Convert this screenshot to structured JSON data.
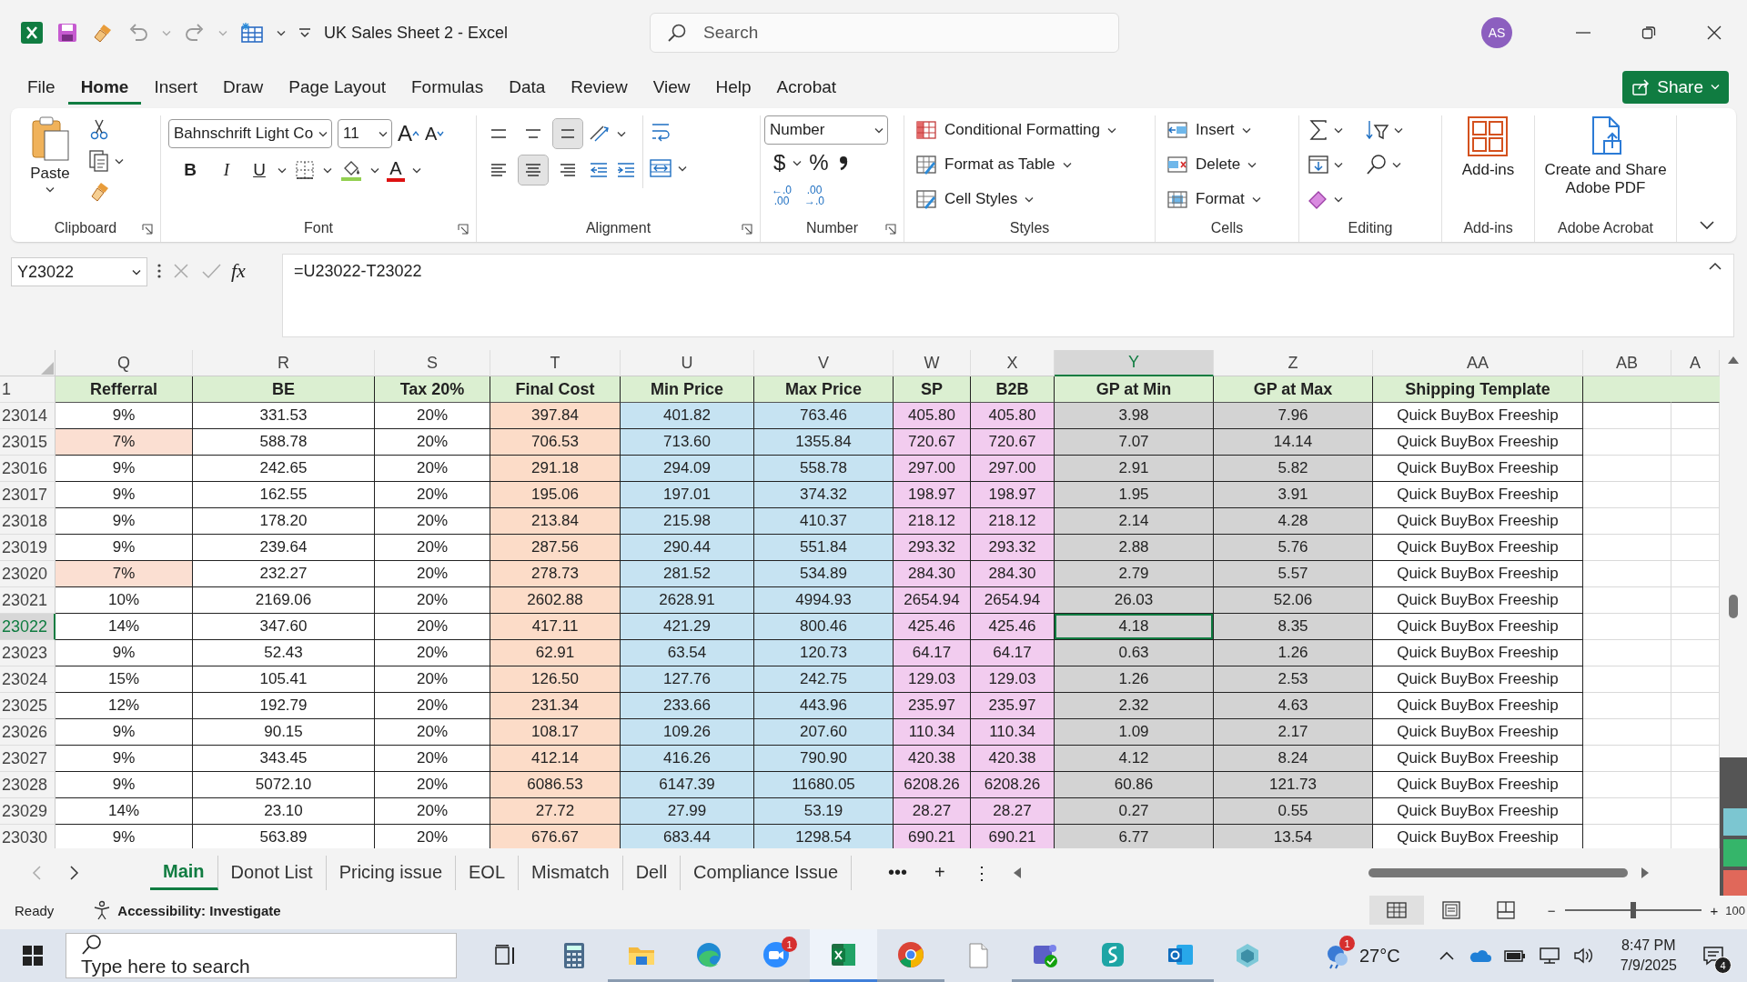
{
  "title_bar": {
    "document_title": "UK Sales Sheet 2  -  Excel",
    "search_placeholder": "Search",
    "avatar": "AS"
  },
  "menu_tabs": [
    {
      "label": "File",
      "selected": false
    },
    {
      "label": "Home",
      "selected": true
    },
    {
      "label": "Insert",
      "selected": false
    },
    {
      "label": "Draw",
      "selected": false
    },
    {
      "label": "Page Layout",
      "selected": false
    },
    {
      "label": "Formulas",
      "selected": false
    },
    {
      "label": "Data",
      "selected": false
    },
    {
      "label": "Review",
      "selected": false
    },
    {
      "label": "View",
      "selected": false
    },
    {
      "label": "Help",
      "selected": false
    },
    {
      "label": "Acrobat",
      "selected": false
    }
  ],
  "share_button": "Share",
  "ribbon": {
    "clipboard": {
      "label": "Clipboard",
      "paste": "Paste"
    },
    "font": {
      "label": "Font",
      "font_name": "Bahnschrift Light Co",
      "font_size": "11",
      "grow": "A",
      "shrink": "A",
      "bold": "B",
      "italic": "I",
      "underline": "U",
      "font_color": "A"
    },
    "alignment": {
      "label": "Alignment",
      "vertical": [
        {
          "kind": "top",
          "selected": false
        },
        {
          "kind": "middle",
          "selected": false
        },
        {
          "kind": "bottom",
          "selected": true
        }
      ],
      "horizontal": [
        {
          "kind": "left",
          "selected": false
        },
        {
          "kind": "center",
          "selected": true
        },
        {
          "kind": "right",
          "selected": false
        }
      ]
    },
    "number": {
      "label": "Number",
      "format": "Number",
      "currency": "$",
      "percent": "%",
      "increase_decimal": [
        "←.0",
        ".00"
      ],
      "decrease_decimal": [
        ".00",
        "→.0"
      ]
    },
    "styles": {
      "label": "Styles",
      "items": [
        {
          "kind": "conditional",
          "label": "Conditional Formatting"
        },
        {
          "kind": "table",
          "label": "Format as Table"
        },
        {
          "kind": "cell",
          "label": "Cell Styles"
        }
      ]
    },
    "cells": {
      "label": "Cells",
      "items": [
        {
          "kind": "insert",
          "label": "Insert"
        },
        {
          "kind": "delete",
          "label": "Delete"
        },
        {
          "kind": "format",
          "label": "Format"
        }
      ]
    },
    "editing": {
      "label": "Editing"
    },
    "add_ins": {
      "label": "Add-ins",
      "button": "Add-ins"
    },
    "adobe": {
      "label": "Adobe Acrobat",
      "button": "Create and Share Adobe PDF"
    }
  },
  "formula_bar": {
    "name_box": "Y23022",
    "fx": "fx",
    "formula": "=U23022-T23022"
  },
  "sheet": {
    "header_row_number": "1",
    "columns": [
      {
        "letter": "Q",
        "header": "Refferral",
        "color": "#ffffff",
        "selected": false
      },
      {
        "letter": "R",
        "header": "BE",
        "color": "#ffffff",
        "selected": false
      },
      {
        "letter": "S",
        "header": "Tax 20%",
        "color": "#ffffff",
        "selected": false
      },
      {
        "letter": "T",
        "header": "Final Cost",
        "color": "#fcdcc8",
        "selected": false
      },
      {
        "letter": "U",
        "header": "Min Price",
        "color": "#c6e3f2",
        "selected": false
      },
      {
        "letter": "V",
        "header": "Max Price",
        "color": "#c6e3f2",
        "selected": false
      },
      {
        "letter": "W",
        "header": "SP",
        "color": "#f2ccef",
        "selected": false
      },
      {
        "letter": "X",
        "header": "B2B",
        "color": "#f2ccef",
        "selected": false
      },
      {
        "letter": "Y",
        "header": "GP at Min",
        "color": "#d3d3d3",
        "selected": true
      },
      {
        "letter": "Z",
        "header": "GP at Max",
        "color": "#d3d3d3",
        "selected": false
      },
      {
        "letter": "AA",
        "header": "Shipping Template",
        "color": "#ffffff",
        "selected": false
      },
      {
        "letter": "AB",
        "color": "#ffffff",
        "selected": false
      },
      {
        "letter": "A",
        "color": "#ffffff",
        "selected": false
      }
    ],
    "rows": [
      {
        "number": "23014",
        "selected": false,
        "referral_highlight": false,
        "cells": [
          "9%",
          "331.53",
          "20%",
          "397.84",
          "401.82",
          "763.46",
          "405.80",
          "405.80",
          "3.98",
          "7.96",
          "Quick BuyBox Freeship"
        ]
      },
      {
        "number": "23015",
        "selected": false,
        "referral_highlight": true,
        "cells": [
          "7%",
          "588.78",
          "20%",
          "706.53",
          "713.60",
          "1355.84",
          "720.67",
          "720.67",
          "7.07",
          "14.14",
          "Quick BuyBox Freeship"
        ]
      },
      {
        "number": "23016",
        "selected": false,
        "referral_highlight": false,
        "cells": [
          "9%",
          "242.65",
          "20%",
          "291.18",
          "294.09",
          "558.78",
          "297.00",
          "297.00",
          "2.91",
          "5.82",
          "Quick BuyBox Freeship"
        ]
      },
      {
        "number": "23017",
        "selected": false,
        "referral_highlight": false,
        "cells": [
          "9%",
          "162.55",
          "20%",
          "195.06",
          "197.01",
          "374.32",
          "198.97",
          "198.97",
          "1.95",
          "3.91",
          "Quick BuyBox Freeship"
        ]
      },
      {
        "number": "23018",
        "selected": false,
        "referral_highlight": false,
        "cells": [
          "9%",
          "178.20",
          "20%",
          "213.84",
          "215.98",
          "410.37",
          "218.12",
          "218.12",
          "2.14",
          "4.28",
          "Quick BuyBox Freeship"
        ]
      },
      {
        "number": "23019",
        "selected": false,
        "referral_highlight": false,
        "cells": [
          "9%",
          "239.64",
          "20%",
          "287.56",
          "290.44",
          "551.84",
          "293.32",
          "293.32",
          "2.88",
          "5.76",
          "Quick BuyBox Freeship"
        ]
      },
      {
        "number": "23020",
        "selected": false,
        "referral_highlight": true,
        "cells": [
          "7%",
          "232.27",
          "20%",
          "278.73",
          "281.52",
          "534.89",
          "284.30",
          "284.30",
          "2.79",
          "5.57",
          "Quick BuyBox Freeship"
        ]
      },
      {
        "number": "23021",
        "selected": false,
        "referral_highlight": false,
        "cells": [
          "10%",
          "2169.06",
          "20%",
          "2602.88",
          "2628.91",
          "4994.93",
          "2654.94",
          "2654.94",
          "26.03",
          "52.06",
          "Quick BuyBox Freeship"
        ]
      },
      {
        "number": "23022",
        "selected": true,
        "referral_highlight": false,
        "cells": [
          "14%",
          "347.60",
          "20%",
          "417.11",
          "421.29",
          "800.46",
          "425.46",
          "425.46",
          "4.18",
          "8.35",
          "Quick BuyBox Freeship"
        ]
      },
      {
        "number": "23023",
        "selected": false,
        "referral_highlight": false,
        "cells": [
          "9%",
          "52.43",
          "20%",
          "62.91",
          "63.54",
          "120.73",
          "64.17",
          "64.17",
          "0.63",
          "1.26",
          "Quick BuyBox Freeship"
        ]
      },
      {
        "number": "23024",
        "selected": false,
        "referral_highlight": false,
        "cells": [
          "15%",
          "105.41",
          "20%",
          "126.50",
          "127.76",
          "242.75",
          "129.03",
          "129.03",
          "1.26",
          "2.53",
          "Quick BuyBox Freeship"
        ]
      },
      {
        "number": "23025",
        "selected": false,
        "referral_highlight": false,
        "cells": [
          "12%",
          "192.79",
          "20%",
          "231.34",
          "233.66",
          "443.96",
          "235.97",
          "235.97",
          "2.32",
          "4.63",
          "Quick BuyBox Freeship"
        ]
      },
      {
        "number": "23026",
        "selected": false,
        "referral_highlight": false,
        "cells": [
          "9%",
          "90.15",
          "20%",
          "108.17",
          "109.26",
          "207.60",
          "110.34",
          "110.34",
          "1.09",
          "2.17",
          "Quick BuyBox Freeship"
        ]
      },
      {
        "number": "23027",
        "selected": false,
        "referral_highlight": false,
        "cells": [
          "9%",
          "343.45",
          "20%",
          "412.14",
          "416.26",
          "790.90",
          "420.38",
          "420.38",
          "4.12",
          "8.24",
          "Quick BuyBox Freeship"
        ]
      },
      {
        "number": "23028",
        "selected": false,
        "referral_highlight": false,
        "cells": [
          "9%",
          "5072.10",
          "20%",
          "6086.53",
          "6147.39",
          "11680.05",
          "6208.26",
          "6208.26",
          "60.86",
          "121.73",
          "Quick BuyBox Freeship"
        ]
      },
      {
        "number": "23029",
        "selected": false,
        "referral_highlight": false,
        "cells": [
          "14%",
          "23.10",
          "20%",
          "27.72",
          "27.99",
          "53.19",
          "28.27",
          "28.27",
          "0.27",
          "0.55",
          "Quick BuyBox Freeship"
        ]
      },
      {
        "number": "23030",
        "selected": false,
        "referral_highlight": false,
        "cells": [
          "9%",
          "563.89",
          "20%",
          "676.67",
          "683.44",
          "1298.54",
          "690.21",
          "690.21",
          "6.77",
          "13.54",
          "Quick BuyBox Freeship"
        ]
      }
    ]
  },
  "sheet_tabs": {
    "tabs": [
      {
        "label": "Main",
        "selected": true
      },
      {
        "label": "Donot List",
        "selected": false
      },
      {
        "label": "Pricing issue",
        "selected": false
      },
      {
        "label": "EOL",
        "selected": false
      },
      {
        "label": "Mismatch",
        "selected": false
      },
      {
        "label": "Dell",
        "selected": false
      },
      {
        "label": "Compliance Issue",
        "selected": false
      }
    ],
    "more": "•••",
    "add": "+",
    "options": "⋮"
  },
  "status_bar": {
    "status": "Ready",
    "accessibility": "Accessibility: Investigate",
    "views": [
      {
        "kind": "normal",
        "selected": true
      },
      {
        "kind": "page_layout",
        "selected": false
      },
      {
        "kind": "page_break",
        "selected": false
      }
    ],
    "zoom_out": "−",
    "zoom_in": "+",
    "zoom": {
      "level": 0.5
    },
    "zoom_text": "100"
  },
  "taskbar": {
    "search_placeholder": "Type here to search",
    "apps": [
      {
        "kind": "task_view",
        "running": false,
        "active": false
      },
      {
        "kind": "calculator",
        "running": false,
        "active": false
      },
      {
        "kind": "folder",
        "running": true,
        "active": false
      },
      {
        "kind": "edge",
        "running": true,
        "active": false
      },
      {
        "kind": "zoom",
        "running": true,
        "active": false,
        "badge": "1"
      },
      {
        "kind": "excel",
        "running": true,
        "active": true
      },
      {
        "kind": "chrome",
        "running": true,
        "active": false
      },
      {
        "kind": "notepad",
        "running": false,
        "active": false
      },
      {
        "kind": "teams",
        "running": true,
        "active": false
      },
      {
        "kind": "surfshark",
        "running": true,
        "active": false
      },
      {
        "kind": "outlook",
        "running": true,
        "active": false
      },
      {
        "kind": "hexagon",
        "running": false,
        "active": false
      }
    ],
    "weather": {
      "badge": "1",
      "temperature": "27°C"
    },
    "time": "8:47 PM",
    "date": "7/9/2025",
    "notifications": "4"
  }
}
